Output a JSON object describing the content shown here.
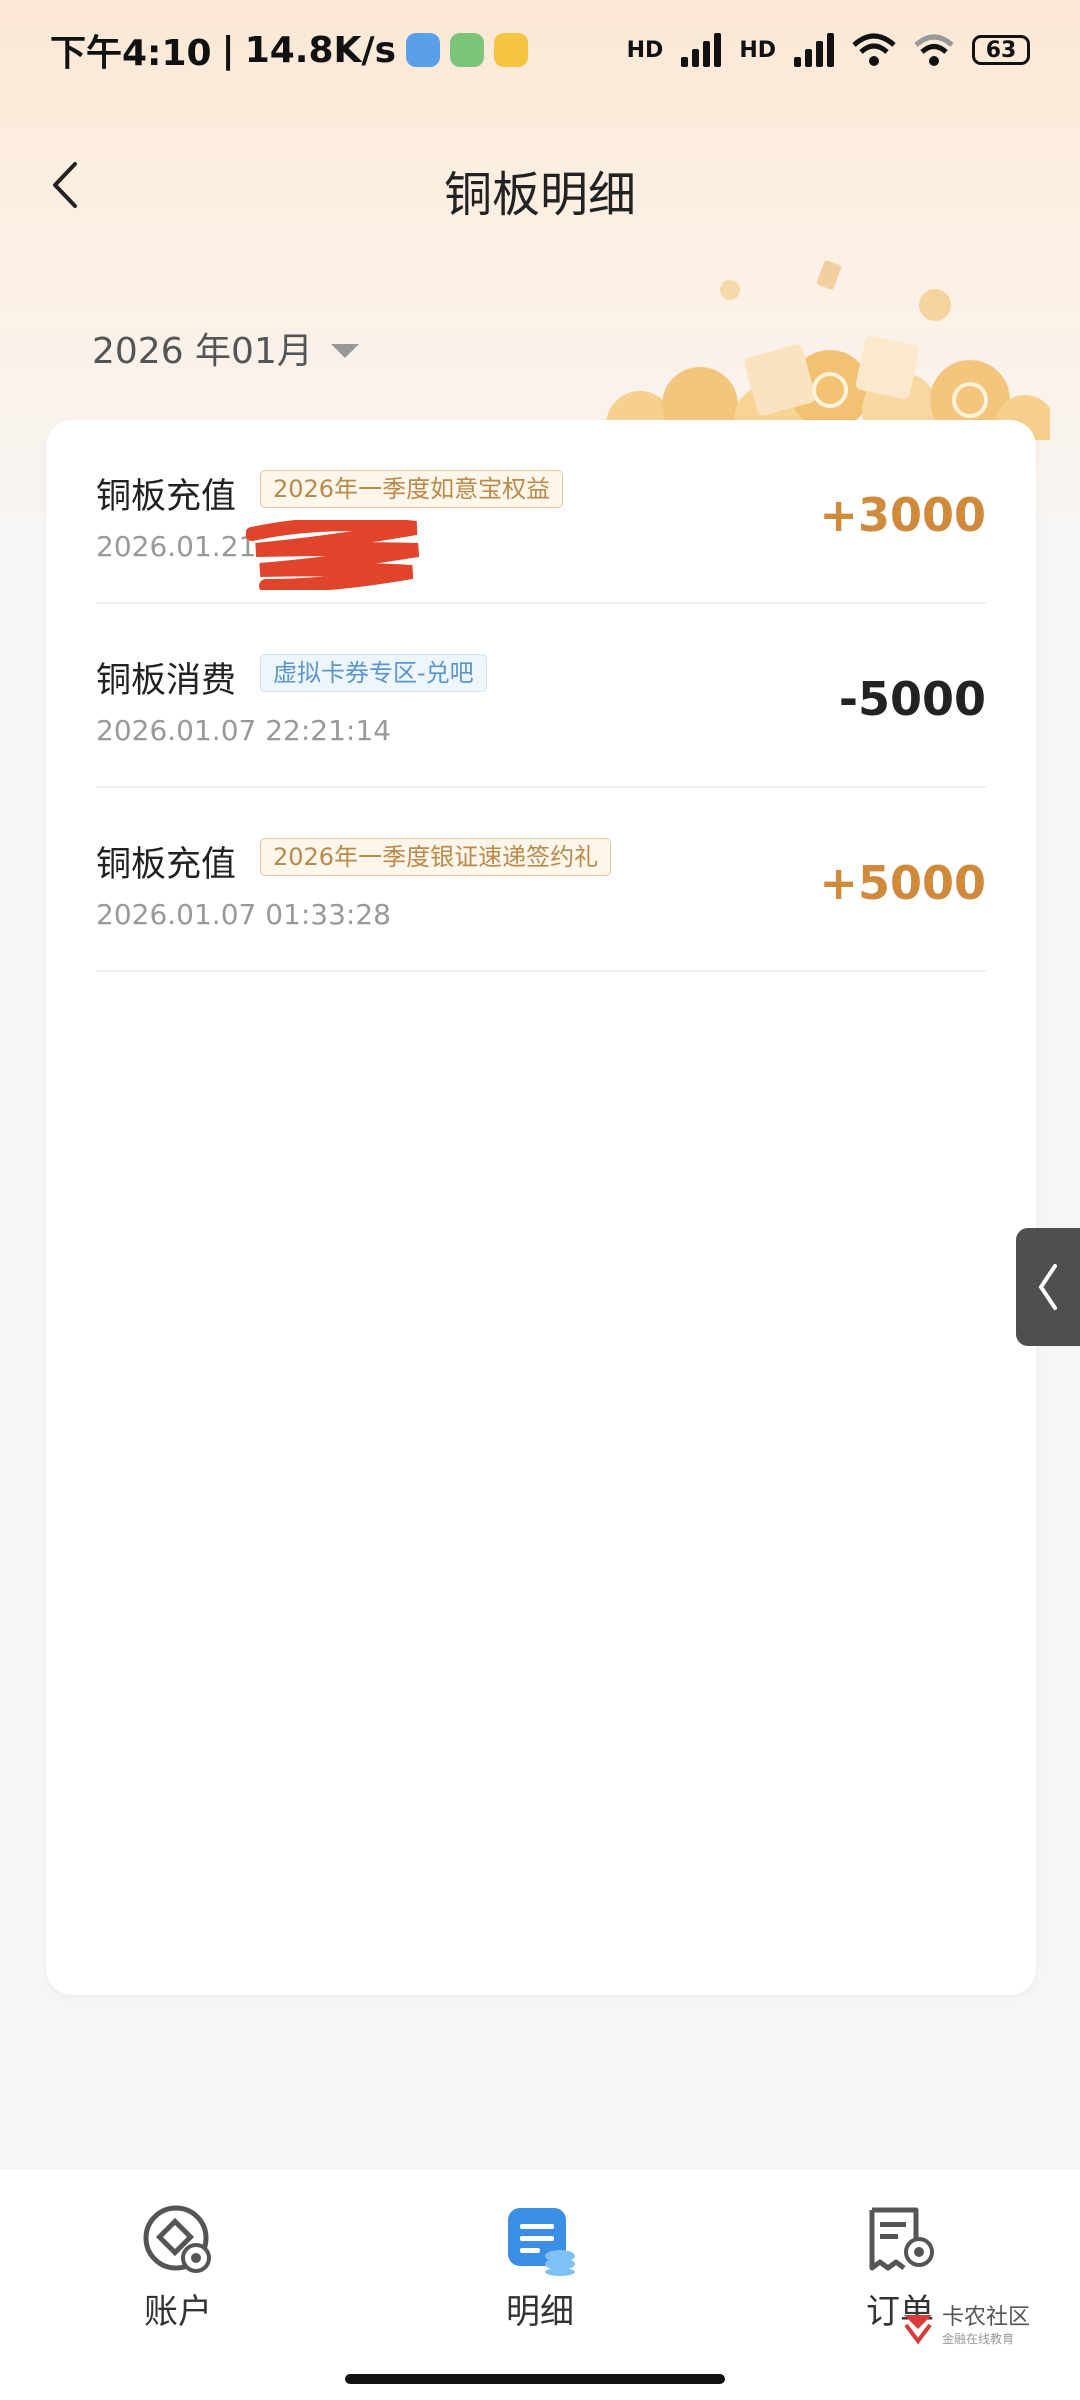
{
  "status_bar": {
    "time": "下午4:10",
    "network_speed": "14.8K/s",
    "battery": "63",
    "hd1": "HD",
    "hd2": "HD"
  },
  "header": {
    "title": "铜板明细"
  },
  "month_selector": {
    "value": "2026 年01月"
  },
  "transactions": [
    {
      "type": "铜板充值",
      "tag": "2026年一季度如意宝权益",
      "time": "2026.01.21",
      "amount": "+3000"
    },
    {
      "type": "铜板消费",
      "tag": "虚拟卡券专区-兑吧",
      "time": "2026.01.07 22:21:14",
      "amount": "-5000"
    },
    {
      "type": "铜板充值",
      "tag": "2026年一季度银证速递签约礼",
      "time": "2026.01.07 01:33:28",
      "amount": "+5000"
    }
  ],
  "bottom_nav": {
    "account": "账户",
    "details": "明细",
    "orders": "订单"
  },
  "watermark": {
    "title": "卡农社区",
    "subtitle": "金融在线教育"
  },
  "colors": {
    "accent_gold": "#d08a3c",
    "active_blue": "#3a8ee6"
  }
}
